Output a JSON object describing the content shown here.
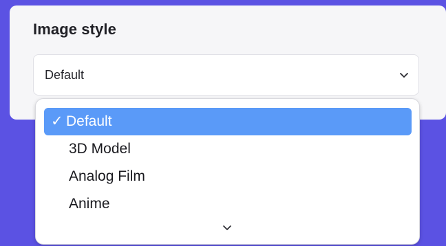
{
  "colors": {
    "background": "#5b52e3",
    "card": "#f6f6f8",
    "selected_option": "#5a9af8"
  },
  "image_style": {
    "title": "Image style",
    "selected_value": "Default",
    "options": [
      {
        "label": "Default",
        "selected": true,
        "check": "✓"
      },
      {
        "label": "3D Model",
        "selected": false
      },
      {
        "label": "Analog Film",
        "selected": false
      },
      {
        "label": "Anime",
        "selected": false
      }
    ],
    "more_icon": "chevron-down-icon"
  }
}
